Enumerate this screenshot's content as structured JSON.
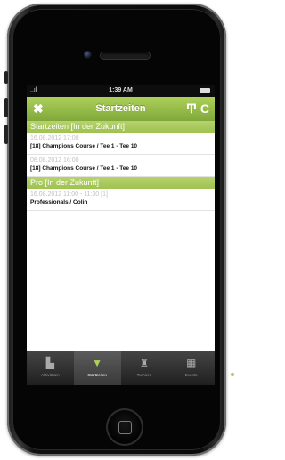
{
  "status_bar": {
    "signal": "..ıl",
    "time": "1:39 AM"
  },
  "nav": {
    "title": "Startzeiten",
    "close_glyph": "✖",
    "filter_glyph": "Ͳ",
    "reload_glyph": "C"
  },
  "sections": [
    {
      "header": "Startzeiten   [In der Zukunft]",
      "items": [
        {
          "date": "16.08.2012 17:00",
          "course": "[18] Champions Course / Tee 1 - Tee 10"
        },
        {
          "date": "08.08.2012 16:00",
          "course": "[18] Champions Course / Tee 1 - Tee 10"
        }
      ]
    },
    {
      "header": "Pro   [In der Zukunft]",
      "items": [
        {
          "date": "16.08.2012 11:00 - 11:30 [1]",
          "course": "Professionals / Colin"
        }
      ]
    }
  ],
  "tabs": [
    {
      "label": "Aktivitäten",
      "icon": "▙"
    },
    {
      "label": "Startzeiten",
      "icon": "▼"
    },
    {
      "label": "Turniere",
      "icon": "♜"
    },
    {
      "label": "Events",
      "icon": "▦"
    }
  ],
  "colors": {
    "accent": "#9ec250",
    "tabbar": "#2a2a2a"
  }
}
